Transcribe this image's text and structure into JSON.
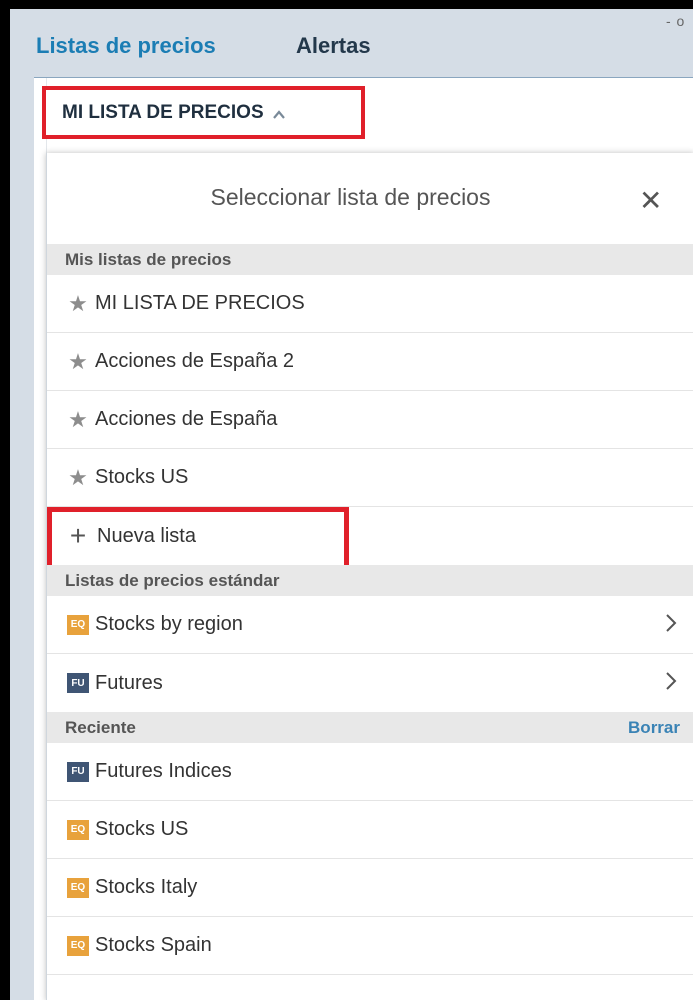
{
  "tabs": {
    "price_lists": "Listas de precios",
    "alerts": "Alertas"
  },
  "corner_mark": "- o",
  "selector": {
    "label": "MI LISTA DE PRECIOS"
  },
  "dropdown": {
    "title": "Seleccionar lista de precios",
    "sections": {
      "mine": "Mis listas de precios",
      "standard": "Listas de precios estándar",
      "recent": "Reciente",
      "recent_action": "Borrar"
    },
    "my_lists": [
      "MI LISTA DE PRECIOS",
      "Acciones de España 2",
      "Acciones de España",
      "Stocks US"
    ],
    "new_list": "Nueva lista",
    "standard_lists": [
      {
        "badge": "EQ",
        "label": "Stocks by region"
      },
      {
        "badge": "FU",
        "label": "Futures"
      }
    ],
    "recent_lists": [
      {
        "badge": "FU",
        "label": "Futures Indices"
      },
      {
        "badge": "EQ",
        "label": "Stocks US"
      },
      {
        "badge": "EQ",
        "label": "Stocks Italy"
      },
      {
        "badge": "EQ",
        "label": "Stocks Spain"
      }
    ]
  },
  "colors": {
    "accent_blue": "#1b7db4",
    "highlight_red": "#e0202a",
    "eq_badge": "#e8a23c",
    "fu_badge": "#3f5574"
  },
  "icons": {
    "star": "star-icon",
    "plus": "plus-icon",
    "close": "close-icon",
    "chevron_up": "chevron-up-icon",
    "chevron_right": "chevron-right-icon"
  }
}
